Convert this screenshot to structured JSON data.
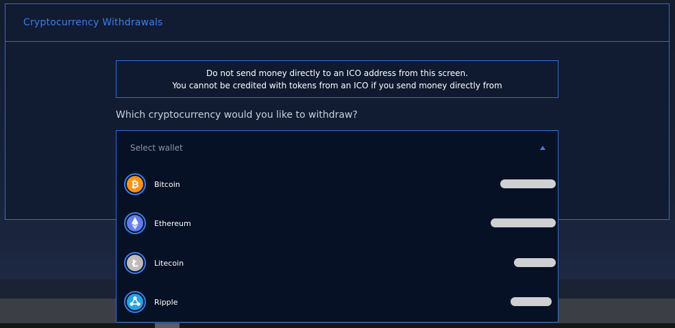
{
  "card": {
    "title": "Cryptocurrency Withdrawals"
  },
  "notice": {
    "line1": "Do not send money directly to an ICO address from this screen.",
    "line2": "You cannot be credited with tokens from an ICO if you send money directly from"
  },
  "question": "Which cryptocurrency would you like to withdraw?",
  "select": {
    "placeholder": "Select wallet",
    "expanded": true
  },
  "wallets": [
    {
      "name": "Bitcoin",
      "icon": "bitcoin-icon",
      "color": "#f7931a",
      "balance_redacted": true
    },
    {
      "name": "Ethereum",
      "icon": "ethereum-icon",
      "color": "#627eea",
      "balance_redacted": true
    },
    {
      "name": "Litecoin",
      "icon": "litecoin-icon",
      "color": "#bfbbbb",
      "balance_redacted": true
    },
    {
      "name": "Ripple",
      "icon": "ripple-icon",
      "color": "#23a3e6",
      "balance_redacted": true
    }
  ],
  "colors": {
    "accent": "#2f6fd6",
    "title": "#3d7ee6",
    "panel": "#111b31",
    "dropdown": "#071126"
  }
}
